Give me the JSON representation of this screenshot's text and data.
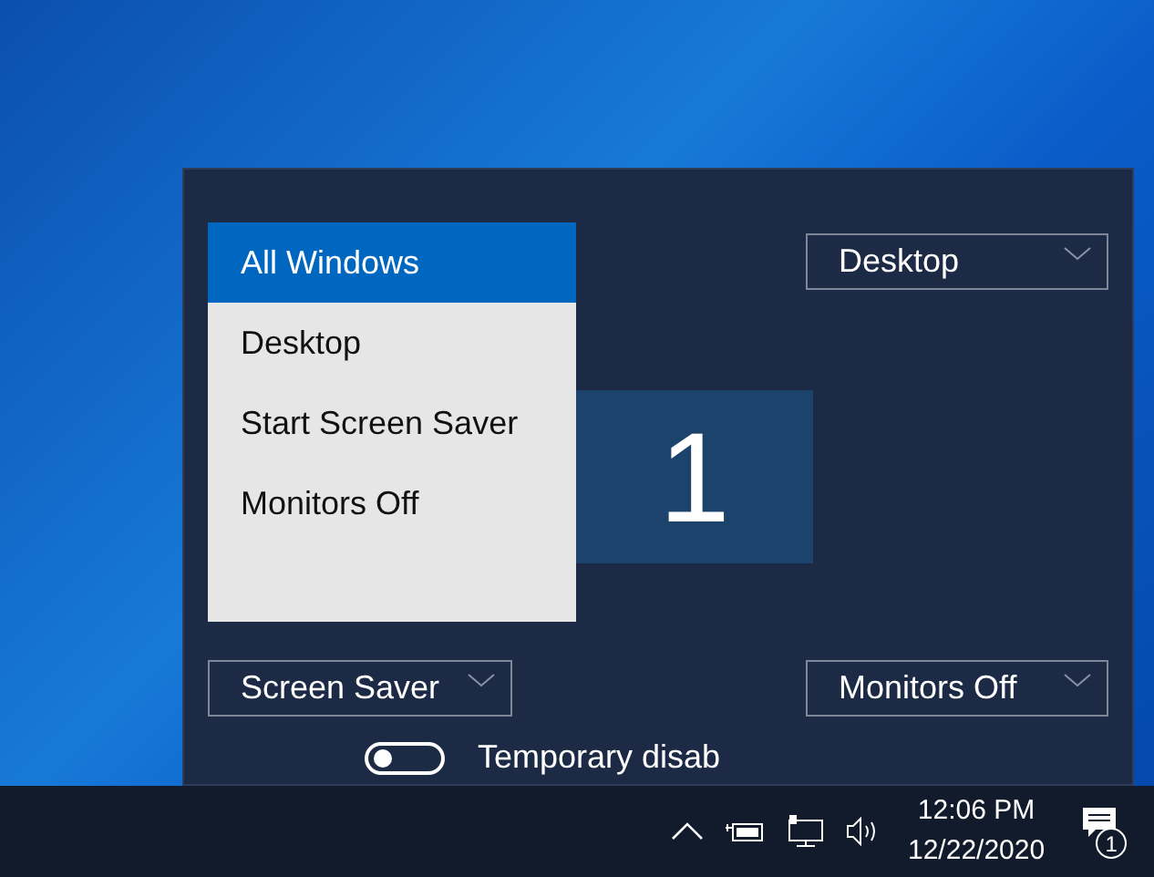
{
  "panel": {
    "menu": {
      "items": [
        {
          "label": "All Windows",
          "selected": true
        },
        {
          "label": "Desktop",
          "selected": false
        },
        {
          "label": "Start Screen Saver",
          "selected": false
        },
        {
          "label": "Monitors Off",
          "selected": false
        }
      ]
    },
    "dropdowns": [
      {
        "value": "Desktop"
      },
      {
        "value": "Screen Saver"
      },
      {
        "value": "Monitors Off"
      }
    ],
    "monitor": {
      "label": "1"
    },
    "toggle": {
      "label": "Temporary disab",
      "on": false
    }
  },
  "taskbar": {
    "time": "12:06 PM",
    "date": "12/22/2020",
    "notifications": "1"
  }
}
